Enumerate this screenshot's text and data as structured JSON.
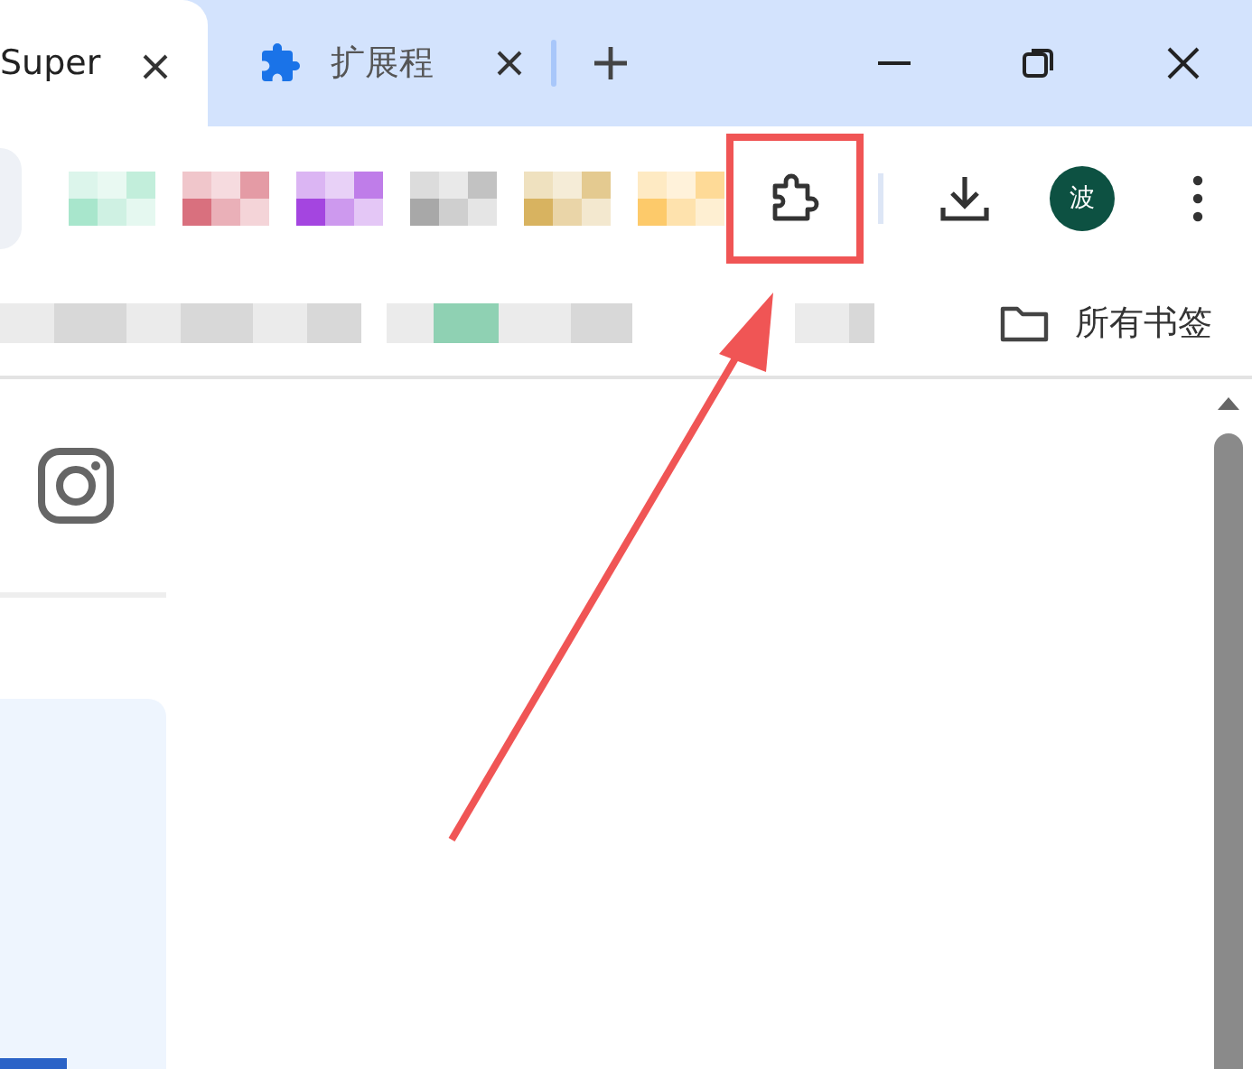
{
  "tabs": [
    {
      "title": "Super",
      "selected": true,
      "has_icon": false
    },
    {
      "title": "扩展程",
      "selected": false,
      "has_icon": true
    }
  ],
  "toolbar": {
    "extensions": [
      {
        "color": "#a8e6cc"
      },
      {
        "color": "#d9707e"
      },
      {
        "color": "#a445e0"
      },
      {
        "color": "#a8a8a8"
      },
      {
        "color": "#d8b360"
      },
      {
        "color": "#fdca6a"
      }
    ],
    "avatar": "波"
  },
  "bookmarks_bar": {
    "folder": "所有书签"
  }
}
